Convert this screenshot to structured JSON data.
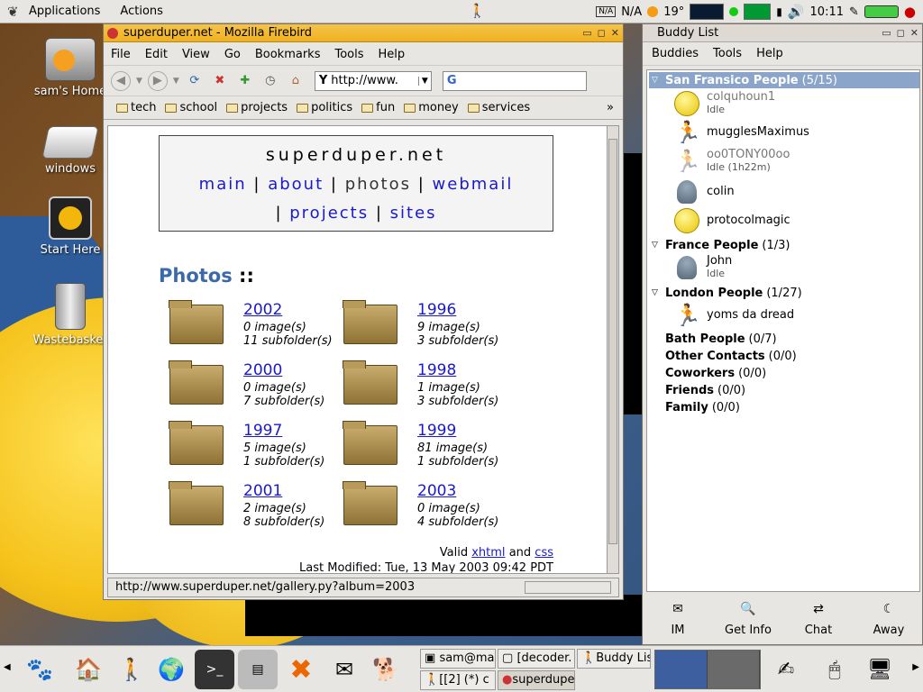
{
  "top_panel": {
    "menus": [
      "Applications",
      "Actions"
    ],
    "weather": "N/A",
    "temperature": "19°",
    "clock": "10:11"
  },
  "desktop_icons": [
    {
      "label": "sam's Home",
      "icon": "home-folder-icon"
    },
    {
      "label": "windows",
      "icon": "drive-icon"
    },
    {
      "label": "Start Here",
      "icon": "start-here-icon"
    },
    {
      "label": "Wastebasket",
      "icon": "trash-icon"
    }
  ],
  "firebird": {
    "title": "superduper.net - Mozilla Firebird",
    "menu": [
      "File",
      "Edit",
      "View",
      "Go",
      "Bookmarks",
      "Tools",
      "Help"
    ],
    "url": "http://www.",
    "search_logo": "G",
    "bookmarks": [
      "tech",
      "school",
      "projects",
      "politics",
      "fun",
      "money",
      "services"
    ],
    "status_url": "http://www.superduper.net/gallery.py?album=2003",
    "page": {
      "site_title": "superduper.net",
      "nav_row1": [
        "main",
        "about",
        "photos",
        "webmail"
      ],
      "nav_row2": [
        "projects",
        "sites"
      ],
      "nav_sep": "|",
      "current_nav": "photos",
      "heading": "Photos",
      "heading_suffix": "::",
      "albums": [
        {
          "year": "2002",
          "images": "0 image(s)",
          "subfolders": "11 subfolder(s)"
        },
        {
          "year": "1996",
          "images": "9 image(s)",
          "subfolders": "3 subfolder(s)"
        },
        {
          "year": "2000",
          "images": "0 image(s)",
          "subfolders": "7 subfolder(s)"
        },
        {
          "year": "1998",
          "images": "1 image(s)",
          "subfolders": "3 subfolder(s)"
        },
        {
          "year": "1997",
          "images": "5 image(s)",
          "subfolders": "1 subfolder(s)"
        },
        {
          "year": "1999",
          "images": "81 image(s)",
          "subfolders": "1 subfolder(s)"
        },
        {
          "year": "2001",
          "images": "2 image(s)",
          "subfolders": "8 subfolder(s)"
        },
        {
          "year": "2003",
          "images": "0 image(s)",
          "subfolders": "4 subfolder(s)"
        }
      ],
      "valid_text": "Valid",
      "xhtml": "xhtml",
      "and": "and",
      "css": "css",
      "last_modified": "Last Modified: Tue, 13 May 2003 09:42 PDT"
    }
  },
  "buddy_list": {
    "title": "Buddy List",
    "menu": [
      "Buddies",
      "Tools",
      "Help"
    ],
    "groups": [
      {
        "name": "San Fransico People",
        "count": "(5/15)",
        "expanded": true,
        "selected": true
      },
      {
        "name": "France People",
        "count": "(1/3)",
        "expanded": true
      },
      {
        "name": "London People",
        "count": "(1/27)",
        "expanded": true
      },
      {
        "name": "Bath People",
        "count": "(0/7)"
      },
      {
        "name": "Other Contacts",
        "count": "(0/0)"
      },
      {
        "name": "Coworkers",
        "count": "(0/0)"
      },
      {
        "name": "Friends",
        "count": "(0/0)"
      },
      {
        "name": "Family",
        "count": "(0/0)"
      }
    ],
    "buddies": [
      {
        "name": "colquhoun1",
        "status": "Idle",
        "idle": true
      },
      {
        "name": "mugglesMaximus",
        "status": ""
      },
      {
        "name": "oo0TONY00oo",
        "status": "Idle (1h22m)",
        "idle": true
      },
      {
        "name": "colin",
        "status": ""
      },
      {
        "name": "protocolmagic",
        "status": ""
      },
      {
        "name": "John",
        "status": "Idle",
        "idle": true
      },
      {
        "name": "yoms da dread",
        "status": ""
      }
    ],
    "buttons": [
      "IM",
      "Get Info",
      "Chat",
      "Away"
    ]
  },
  "taskbar": {
    "tasks": [
      "sam@mag",
      "[decoder.",
      "Buddy List",
      "[[2] (*) c",
      "superdupe"
    ]
  },
  "colors": {
    "link": "#1a1acc",
    "heading": "#3a6aaa",
    "title_active": "#f0b020"
  }
}
